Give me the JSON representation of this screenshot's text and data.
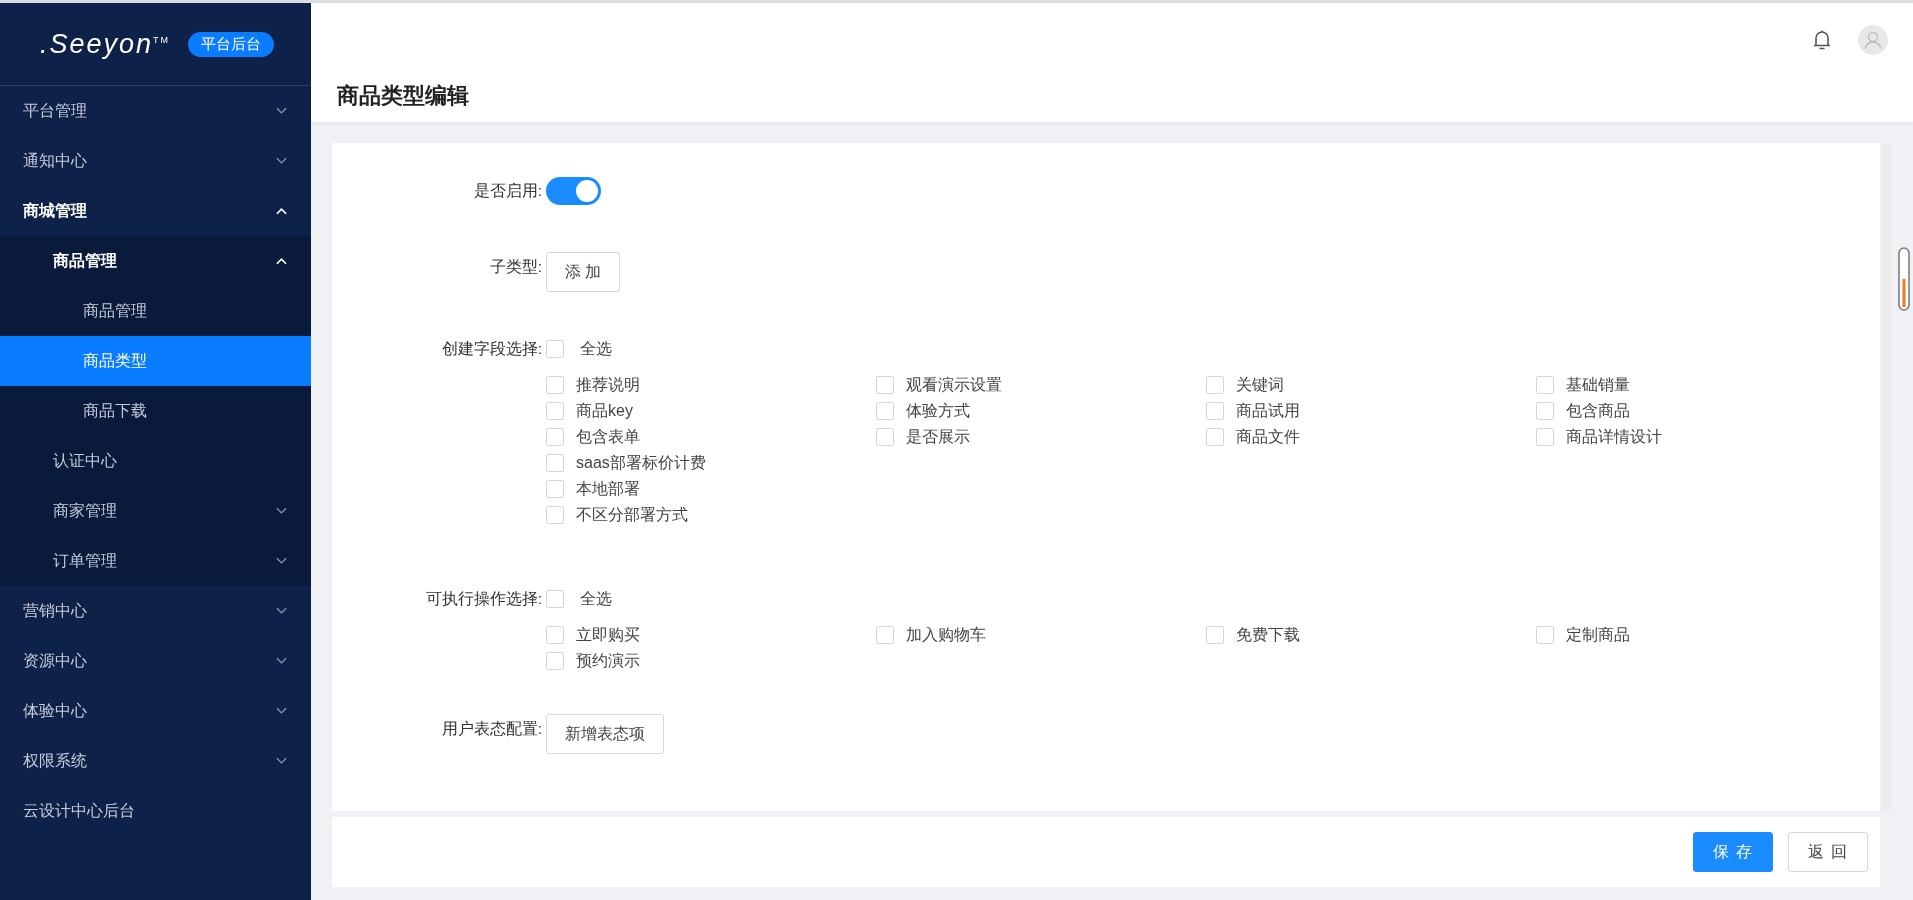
{
  "sidebar": {
    "logo": {
      "brand": ".Seeyon",
      "trademark": "TM",
      "badge": "平台后台"
    },
    "items": [
      {
        "label": "平台管理",
        "expanded": false,
        "selected": false
      },
      {
        "label": "通知中心",
        "expanded": false,
        "selected": false
      },
      {
        "label": "商城管理",
        "expanded": true,
        "selected": false,
        "children": [
          {
            "label": "商品管理",
            "expanded": true,
            "selected": false,
            "children": [
              {
                "label": "商品管理",
                "selected": false
              },
              {
                "label": "商品类型",
                "selected": true
              },
              {
                "label": "商品下载",
                "selected": false
              }
            ]
          },
          {
            "label": "认证中心",
            "selected": false
          },
          {
            "label": "商家管理",
            "expanded": false,
            "selected": false
          },
          {
            "label": "订单管理",
            "expanded": false,
            "selected": false
          }
        ]
      },
      {
        "label": "营销中心",
        "expanded": false,
        "selected": false
      },
      {
        "label": "资源中心",
        "expanded": false,
        "selected": false
      },
      {
        "label": "体验中心",
        "expanded": false,
        "selected": false
      },
      {
        "label": "权限系统",
        "expanded": false,
        "selected": false
      },
      {
        "label": "云设计中心后台",
        "selected": false
      }
    ]
  },
  "header": {
    "title": "商品类型编辑"
  },
  "form": {
    "enabled": {
      "label": "是否启用:",
      "on": true
    },
    "subtype": {
      "label": "子类型:",
      "button": "添 加"
    },
    "fields": {
      "label": "创建字段选择:",
      "select_all": {
        "label": "全选",
        "checked": false
      },
      "options": [
        {
          "label": "推荐说明",
          "checked": false
        },
        {
          "label": "观看演示设置",
          "checked": false
        },
        {
          "label": "关键词",
          "checked": false
        },
        {
          "label": "基础销量",
          "checked": false
        },
        {
          "label": "商品key",
          "checked": false
        },
        {
          "label": "体验方式",
          "checked": false
        },
        {
          "label": "商品试用",
          "checked": false
        },
        {
          "label": "包含商品",
          "checked": false
        },
        {
          "label": "包含表单",
          "checked": false
        },
        {
          "label": "是否展示",
          "checked": false
        },
        {
          "label": "商品文件",
          "checked": false
        },
        {
          "label": "商品详情设计",
          "checked": false
        }
      ],
      "extra_options": [
        {
          "label": "saas部署标价计费",
          "checked": false
        },
        {
          "label": "本地部署",
          "checked": false
        },
        {
          "label": "不区分部署方式",
          "checked": false
        }
      ]
    },
    "operations": {
      "label": "可执行操作选择:",
      "select_all": {
        "label": "全选",
        "checked": false
      },
      "options": [
        {
          "label": "立即购买",
          "checked": false
        },
        {
          "label": "加入购物车",
          "checked": false
        },
        {
          "label": "免费下载",
          "checked": false
        },
        {
          "label": "定制商品",
          "checked": false
        },
        {
          "label": "预约演示",
          "checked": false
        }
      ]
    },
    "attitude": {
      "label": "用户表态配置:",
      "button": "新增表态项"
    }
  },
  "footer": {
    "buttons": [
      {
        "label": "保 存",
        "kind": "primary"
      },
      {
        "label": "返 回",
        "kind": "default"
      }
    ]
  }
}
